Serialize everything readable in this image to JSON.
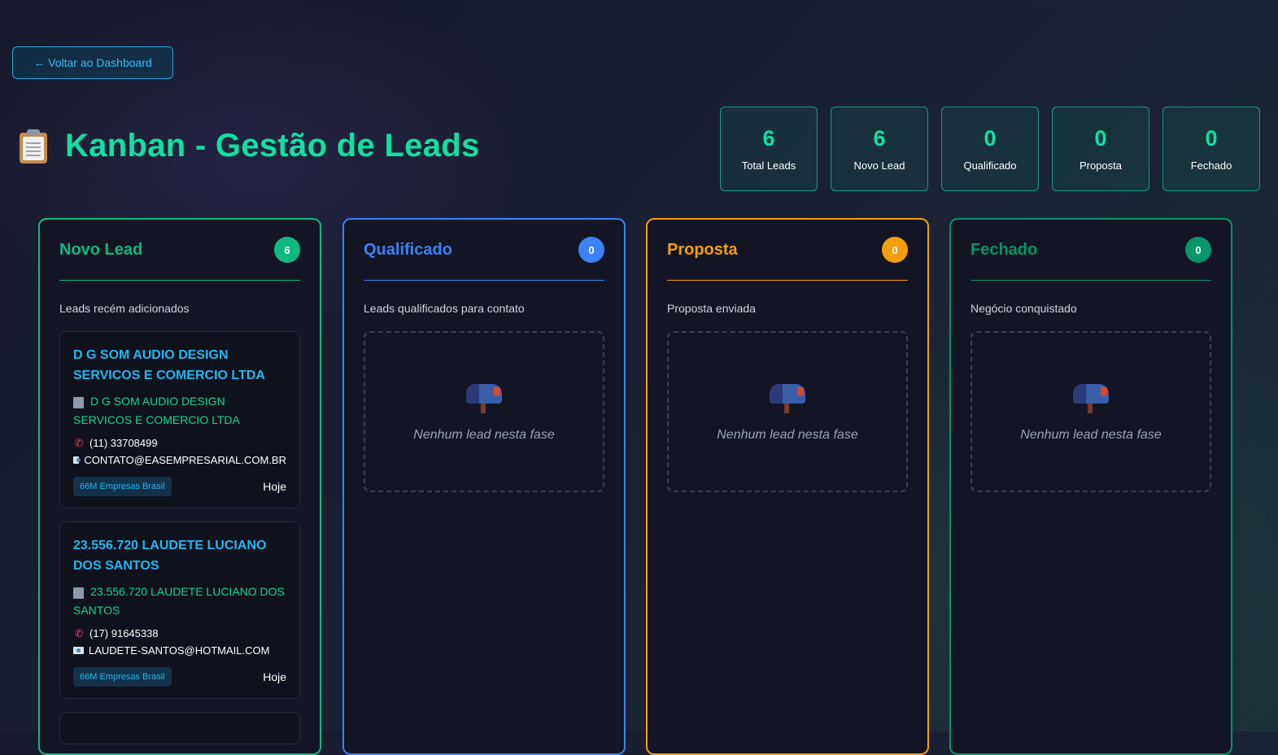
{
  "nav": {
    "back_label": "← Voltar ao Dashboard"
  },
  "header": {
    "icon": "clipboard-icon",
    "title": "Kanban - Gestão de Leads"
  },
  "stats": [
    {
      "value": "6",
      "label": "Total Leads"
    },
    {
      "value": "6",
      "label": "Novo Lead"
    },
    {
      "value": "0",
      "label": "Qualificado"
    },
    {
      "value": "0",
      "label": "Proposta"
    },
    {
      "value": "0",
      "label": "Fechado"
    }
  ],
  "colors": {
    "green": "#10b981",
    "blue": "#3b82f6",
    "orange": "#f59e0b",
    "teal": "#059669",
    "accent": "#10e0a0",
    "link": "#22b8f0"
  },
  "columns": [
    {
      "title": "Novo Lead",
      "count": "6",
      "description": "Leads recém adicionados",
      "cards": [
        {
          "title": "D G SOM AUDIO DESIGN SERVICOS E COMERCIO LTDA",
          "company": "D G SOM AUDIO DESIGN SERVICOS E COMERCIO LTDA",
          "phone": "(11) 33708499",
          "email": "CONTATO@EASEMPRESARIAL.COM.BR",
          "source": "66M Empresas Brasil",
          "date": "Hoje"
        },
        {
          "title": "23.556.720 LAUDETE LUCIANO DOS SANTOS",
          "company": "23.556.720 LAUDETE LUCIANO DOS SANTOS",
          "phone": "(17) 91645338",
          "email": "LAUDETE-SANTOS@HOTMAIL.COM",
          "source": "66M Empresas Brasil",
          "date": "Hoje"
        }
      ]
    },
    {
      "title": "Qualificado",
      "count": "0",
      "description": "Leads qualificados para contato",
      "empty_text": "Nenhum lead nesta fase",
      "empty_icon": "mailbox-icon"
    },
    {
      "title": "Proposta",
      "count": "0",
      "description": "Proposta enviada",
      "empty_text": "Nenhum lead nesta fase",
      "empty_icon": "mailbox-icon"
    },
    {
      "title": "Fechado",
      "count": "0",
      "description": "Negócio conquistado",
      "empty_text": "Nenhum lead nesta fase",
      "empty_icon": "mailbox-icon"
    }
  ]
}
